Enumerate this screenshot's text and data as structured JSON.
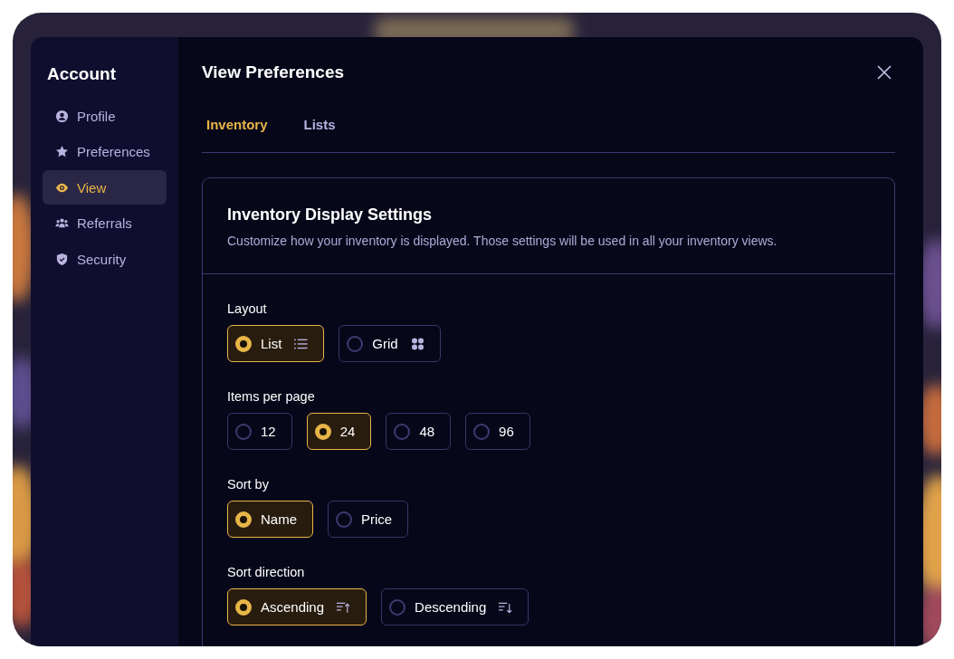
{
  "sidebar": {
    "title": "Account",
    "items": [
      {
        "label": "Profile",
        "selected": false
      },
      {
        "label": "Preferences",
        "selected": false
      },
      {
        "label": "View",
        "selected": true
      },
      {
        "label": "Referrals",
        "selected": false
      },
      {
        "label": "Security",
        "selected": false
      }
    ]
  },
  "dialog": {
    "title": "View Preferences"
  },
  "tabs": [
    {
      "label": "Inventory",
      "selected": true
    },
    {
      "label": "Lists",
      "selected": false
    }
  ],
  "card": {
    "title": "Inventory Display Settings",
    "description": "Customize how your inventory is displayed. Those settings will be used in all your inventory views.",
    "groups": [
      {
        "label": "Layout",
        "options": [
          {
            "label": "List",
            "selected": true,
            "kind": "list"
          },
          {
            "label": "Grid",
            "selected": false,
            "kind": "grid"
          }
        ]
      },
      {
        "label": "Items per page",
        "options": [
          {
            "label": "12",
            "selected": false,
            "kind": "plain"
          },
          {
            "label": "24",
            "selected": true,
            "kind": "plain"
          },
          {
            "label": "48",
            "selected": false,
            "kind": "plain"
          },
          {
            "label": "96",
            "selected": false,
            "kind": "plain"
          }
        ]
      },
      {
        "label": "Sort by",
        "options": [
          {
            "label": "Name",
            "selected": true,
            "kind": "plain"
          },
          {
            "label": "Price",
            "selected": false,
            "kind": "plain"
          }
        ]
      },
      {
        "label": "Sort direction",
        "options": [
          {
            "label": "Ascending",
            "selected": true,
            "kind": "ascending"
          },
          {
            "label": "Descending",
            "selected": false,
            "kind": "descending"
          }
        ]
      }
    ]
  }
}
